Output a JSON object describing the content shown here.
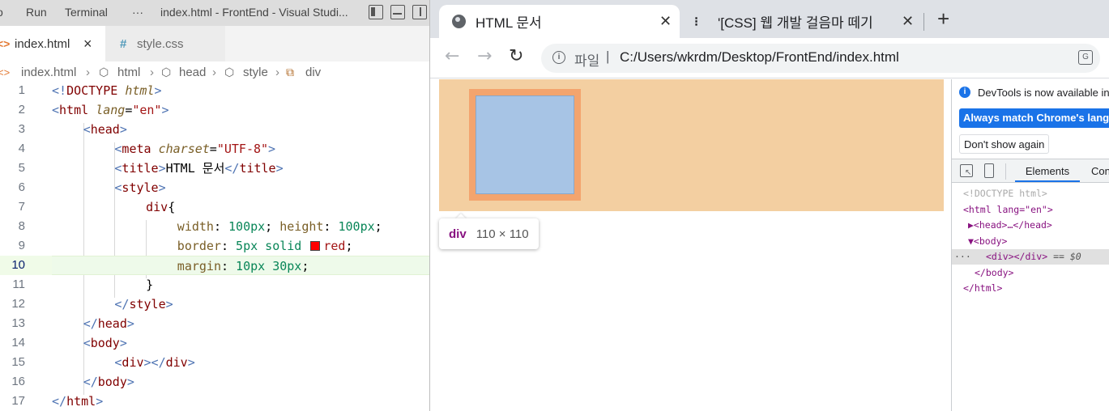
{
  "vscode": {
    "menu": [
      "o",
      "Run",
      "Terminal",
      "···"
    ],
    "window_title": "index.html - FrontEnd - Visual Studi...",
    "tabs": [
      {
        "label": "index.html",
        "icon": "html-file-icon",
        "active": true,
        "close": "×"
      },
      {
        "label": "style.css",
        "icon": "css-file-icon",
        "active": false
      }
    ],
    "breadcrumb": [
      "index.html",
      "html",
      "head",
      "style",
      "div"
    ],
    "current_line": 10,
    "lines": [
      {
        "n": "1",
        "parts": [
          [
            "br",
            "<!"
          ],
          [
            "tag",
            "DOCTYPE "
          ],
          [
            "attr",
            "html"
          ],
          [
            "br",
            ">"
          ]
        ]
      },
      {
        "n": "2",
        "parts": [
          [
            "br",
            "<"
          ],
          [
            "tag",
            "html "
          ],
          [
            "attr",
            "lang"
          ],
          [
            "txt",
            "="
          ],
          [
            "val",
            "\"en\""
          ],
          [
            "br",
            ">"
          ]
        ]
      },
      {
        "n": "3",
        "parts": [
          [
            "br",
            "<"
          ],
          [
            "tag",
            "head"
          ],
          [
            "br",
            ">"
          ]
        ]
      },
      {
        "n": "4",
        "parts": [
          [
            "br",
            "<"
          ],
          [
            "tag",
            "meta "
          ],
          [
            "attr",
            "charset"
          ],
          [
            "txt",
            "="
          ],
          [
            "val",
            "\"UTF-8\""
          ],
          [
            "br",
            ">"
          ]
        ]
      },
      {
        "n": "5",
        "parts": [
          [
            "br",
            "<"
          ],
          [
            "tag",
            "title"
          ],
          [
            "br",
            ">"
          ],
          [
            "txt",
            "HTML 문서"
          ],
          [
            "br",
            "</"
          ],
          [
            "tag",
            "title"
          ],
          [
            "br",
            ">"
          ]
        ]
      },
      {
        "n": "6",
        "parts": [
          [
            "br",
            "<"
          ],
          [
            "tag",
            "style"
          ],
          [
            "br",
            ">"
          ]
        ]
      },
      {
        "n": "7",
        "parts": [
          [
            "sel",
            "div"
          ],
          [
            "txt",
            "{"
          ]
        ]
      },
      {
        "n": "8",
        "parts": [
          [
            "prop",
            "width"
          ],
          [
            "txt",
            ": "
          ],
          [
            "num",
            "100px"
          ],
          [
            "txt",
            "; "
          ],
          [
            "prop",
            "height"
          ],
          [
            "txt",
            ": "
          ],
          [
            "num",
            "100px"
          ],
          [
            "txt",
            ";"
          ]
        ]
      },
      {
        "n": "9",
        "parts": [
          [
            "prop",
            "border"
          ],
          [
            "txt",
            ": "
          ],
          [
            "num",
            "5px"
          ],
          [
            "txt",
            " "
          ],
          [
            "kw",
            "solid"
          ],
          [
            "txt",
            " "
          ],
          [
            "swatch",
            ""
          ],
          [
            "val",
            "red"
          ],
          [
            "txt",
            ";"
          ]
        ]
      },
      {
        "n": "10",
        "parts": [
          [
            "prop",
            "margin"
          ],
          [
            "txt",
            ": "
          ],
          [
            "num",
            "10px"
          ],
          [
            "txt",
            " "
          ],
          [
            "num",
            "30px"
          ],
          [
            "txt",
            ";"
          ]
        ]
      },
      {
        "n": "11",
        "parts": [
          [
            "txt",
            "}"
          ]
        ]
      },
      {
        "n": "12",
        "parts": [
          [
            "br",
            "</"
          ],
          [
            "tag",
            "style"
          ],
          [
            "br",
            ">"
          ]
        ]
      },
      {
        "n": "13",
        "parts": [
          [
            "br",
            "</"
          ],
          [
            "tag",
            "head"
          ],
          [
            "br",
            ">"
          ]
        ]
      },
      {
        "n": "14",
        "parts": [
          [
            "br",
            "<"
          ],
          [
            "tag",
            "body"
          ],
          [
            "br",
            ">"
          ]
        ]
      },
      {
        "n": "15",
        "parts": [
          [
            "br",
            "<"
          ],
          [
            "tag",
            "div"
          ],
          [
            "br",
            "></"
          ],
          [
            "tag",
            "div"
          ],
          [
            "br",
            ">"
          ]
        ]
      },
      {
        "n": "16",
        "parts": [
          [
            "br",
            "</"
          ],
          [
            "tag",
            "body"
          ],
          [
            "br",
            ">"
          ]
        ]
      },
      {
        "n": "17",
        "parts": [
          [
            "br",
            "</"
          ],
          [
            "tag",
            "html"
          ],
          [
            "br",
            ">"
          ]
        ]
      }
    ]
  },
  "chrome": {
    "tabs": [
      {
        "title": "HTML 문서",
        "icon": "globe-icon",
        "active": true,
        "close": "✕"
      },
      {
        "title": "'[CSS] 웹 개발 걸음마 떼기",
        "icon": "dots-icon",
        "active": false,
        "close": "✕"
      }
    ],
    "new_tab": "+",
    "nav": {
      "back": "←",
      "forward": "→",
      "reload": "↻"
    },
    "omnibox": {
      "scheme_label": "파일",
      "separator": "|",
      "url": "C:/Users/wkrdm/Desktop/FrontEnd/index.html"
    },
    "tooltip": {
      "tag": "div",
      "size": "110 × 110"
    },
    "colors": {
      "page_bg": "#f3cfa1",
      "margin": "#f3a46e",
      "content": "#a7c4e5"
    }
  },
  "devtools": {
    "banner_text": "DevTools is now available in",
    "primary_button": "Always match Chrome's language",
    "secondary_button": "Don't show again",
    "tabs": [
      "Elements",
      "Console"
    ],
    "dom": [
      {
        "text": "<!DOCTYPE html>"
      },
      {
        "text": "<html lang=\"en\">"
      },
      {
        "text": "▶<head>…</head>"
      },
      {
        "text": "▼<body>"
      },
      {
        "text": "<div></div>",
        "suffix": " == $0",
        "selected": true,
        "dots": "···"
      },
      {
        "text": "</body>"
      },
      {
        "text": "</html>"
      }
    ]
  }
}
